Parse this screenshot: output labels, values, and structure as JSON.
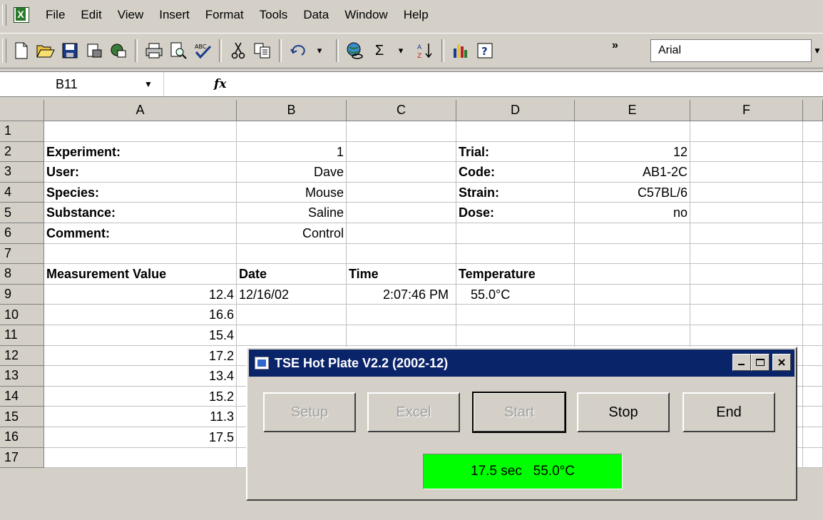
{
  "menubar": {
    "items": [
      {
        "label": "File"
      },
      {
        "label": "Edit"
      },
      {
        "label": "View"
      },
      {
        "label": "Insert"
      },
      {
        "label": "Format"
      },
      {
        "label": "Tools"
      },
      {
        "label": "Data"
      },
      {
        "label": "Window"
      },
      {
        "label": "Help"
      }
    ]
  },
  "toolbar": {
    "font_name": "Arial",
    "icons": [
      "new-icon",
      "open-icon",
      "save-icon",
      "permission-icon",
      "email-icon",
      "print-icon",
      "print-preview-icon",
      "spelling-icon",
      "cut-icon",
      "copy-icon",
      "undo-icon",
      "hyperlink-icon",
      "autosum-icon",
      "sort-ascending-icon",
      "chart-wizard-icon",
      "help-icon"
    ]
  },
  "formula_bar": {
    "name_box": "B11",
    "fx_label": "fx",
    "content": ""
  },
  "sheet": {
    "columns": [
      "A",
      "B",
      "C",
      "D",
      "E",
      "F"
    ],
    "rows": [
      "1",
      "2",
      "3",
      "4",
      "5",
      "6",
      "7",
      "8",
      "9",
      "10",
      "11",
      "12",
      "13",
      "14",
      "15",
      "16",
      "17"
    ],
    "cells": {
      "A2": "Experiment:",
      "B2": "1",
      "D2": "Trial:",
      "E2": "12",
      "A3": "User:",
      "B3": "Dave",
      "D3": "Code:",
      "E3": "AB1-2C",
      "A4": "Species:",
      "B4": "Mouse",
      "D4": "Strain:",
      "E4": "C57BL/6",
      "A5": "Substance:",
      "B5": "Saline",
      "D5": "Dose:",
      "E5": "no",
      "A6": "Comment:",
      "B6": "Control",
      "A8": "Measurement Value",
      "B8": "Date",
      "C8": "Time",
      "D8": "Temperature",
      "A9": "12.4",
      "B9": "12/16/02",
      "C9": "2:07:46 PM",
      "D9": "55.0°C",
      "A10": "16.6",
      "A11": "15.4",
      "A12": "17.2",
      "A13": "13.4",
      "A14": "15.2",
      "A15": "11.3",
      "A16": "17.5"
    }
  },
  "dialog": {
    "title": "TSE Hot Plate V2.2 (2002-12)",
    "buttons": {
      "setup": "Setup",
      "excel": "Excel",
      "start": "Start",
      "stop": "Stop",
      "end": "End"
    },
    "status": "17.5 sec   55.0°C",
    "colors": {
      "titlebar": "#0a246a",
      "status_bg": "#00ff00"
    }
  }
}
